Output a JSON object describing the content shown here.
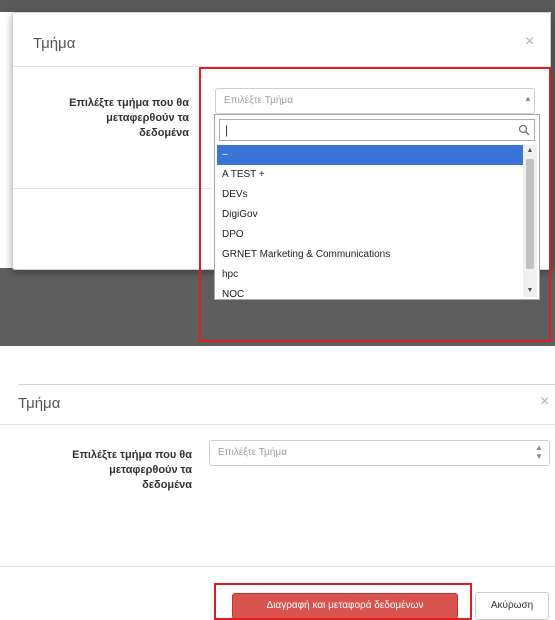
{
  "top_view": {
    "modal_title": "Τμήμα",
    "close_symbol": "×",
    "field_label_lines": [
      "Επιλέξτε τμήμα που θα",
      "μεταφερθούν τα",
      "δεδομένα"
    ],
    "select_placeholder": "Επιλέξτε Τμήμα",
    "search_value": "",
    "options": [
      {
        "label": "–",
        "selected": true
      },
      {
        "label": "A TEST +",
        "selected": false
      },
      {
        "label": "DEVs",
        "selected": false
      },
      {
        "label": "DigiGov",
        "selected": false
      },
      {
        "label": "DPO",
        "selected": false
      },
      {
        "label": "GRNET Marketing & Communications",
        "selected": false
      },
      {
        "label": "hpc",
        "selected": false
      },
      {
        "label": "NOC",
        "selected": false
      }
    ],
    "icons": [
      "search-icon",
      "chevron-down-icon",
      "scroll-up-icon",
      "scroll-down-icon"
    ]
  },
  "bottom_view": {
    "modal_title": "Τμήμα",
    "close_symbol": "×",
    "field_label_lines": [
      "Επιλέξτε τμήμα που θα",
      "μεταφερθούν τα",
      "δεδομένα"
    ],
    "select_placeholder": "Επιλέξτε Τμήμα",
    "delete_button_label": "Διαγραφή και μεταφορά δεδομένων",
    "cancel_button_label": "Ακύρωση"
  },
  "colors": {
    "highlight_frame": "#e01e1e",
    "danger_button": "#d9534f",
    "selected_option": "#3875d7"
  }
}
